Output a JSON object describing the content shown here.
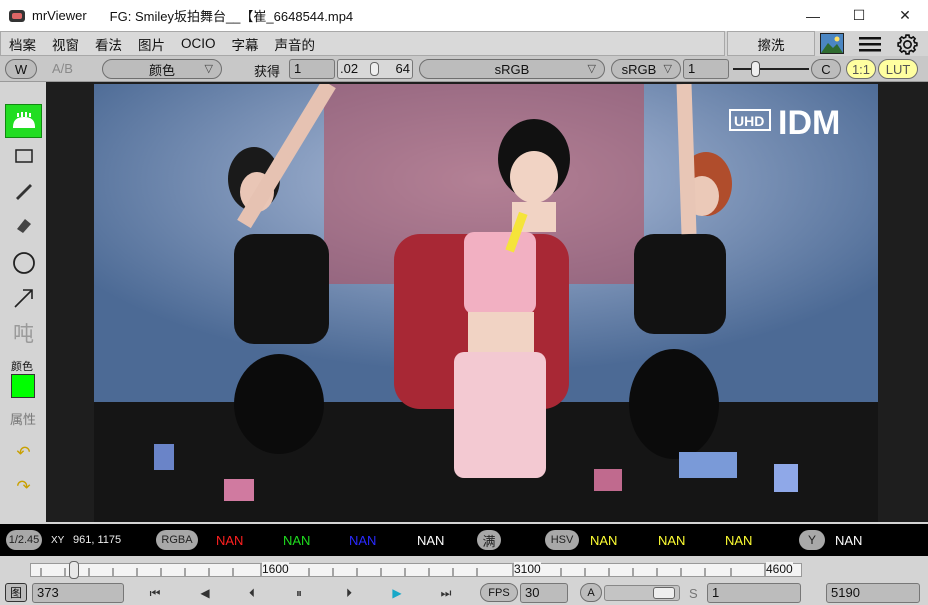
{
  "window": {
    "app_name": "mrViewer",
    "title": "FG: Smiley坂拍舞台__【崔_6648544.mp4",
    "minimize": "—",
    "maximize": "☐",
    "close": "✕"
  },
  "menu": {
    "items": [
      "档案",
      "视窗",
      "看法",
      "图片",
      "OCIO",
      "字幕",
      "声音的"
    ],
    "scrub": "擦洗"
  },
  "toolbar": {
    "w": "W",
    "ab": "A/B",
    "channel": "颜色",
    "gain_label": "获得",
    "gain_value": "1",
    "gamma_low": ".02",
    "gamma_high": "64",
    "input_cs": "sRGB",
    "display_cs": "sRGB",
    "exposure": "1",
    "c": "C",
    "one_one": "1:1",
    "lut": "LUT"
  },
  "tools": {
    "color_label": "颜色",
    "props_label": "属性",
    "text_glyph": "吨",
    "color_hex": "#00ff00"
  },
  "pixel": {
    "zoom": "1/2.45",
    "xy_label": "XY",
    "xy_value": "961,  1175",
    "rgba": "RGBA",
    "r": "NAN",
    "g": "NAN",
    "b": "NAN",
    "a": "NAN",
    "full": "满",
    "hsv": "HSV",
    "h": "NAN",
    "s": "NAN",
    "v": "NAN",
    "y_tag": "Y",
    "y": "NAN"
  },
  "timeline": {
    "marks": [
      "1600",
      "3100",
      "4600"
    ]
  },
  "transport": {
    "pic": "图",
    "frame": "373",
    "fps_label": "FPS",
    "fps": "30",
    "a": "A",
    "s_label": "S",
    "start": "1",
    "end": "5190"
  },
  "video": {
    "watermark_a": "UHD",
    "watermark_b": "IDM"
  },
  "colors": {
    "r": "#ff2020",
    "g": "#1fdc1f",
    "b": "#2a2aff",
    "yellow": "#ffff33",
    "tool_active": "#22dd22"
  }
}
